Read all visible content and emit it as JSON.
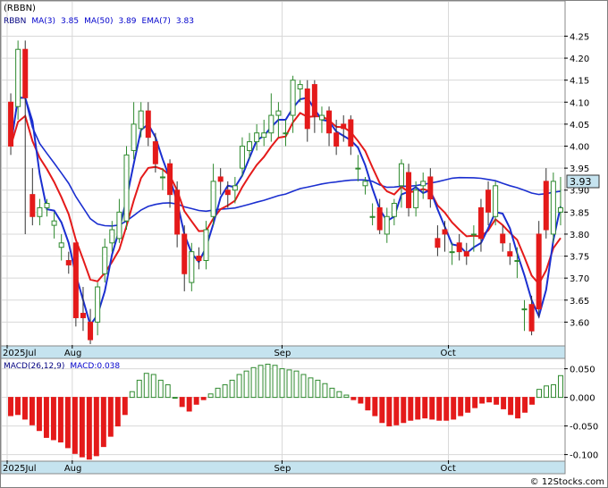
{
  "ticker_title": "(RBBN)",
  "watermark": "© 12Stocks.com",
  "colors": {
    "up": "#2f8a2f",
    "down": "#e41a1a",
    "ma_blue": "#1b2fd0",
    "ema_red": "#e41a1a",
    "axis_strip": "#c5e3ef",
    "price_box": "#c5e3ef",
    "grid": "#d8d8d8"
  },
  "chart_data": [
    {
      "type": "candlestick",
      "legend": [
        {
          "text": "RBBN",
          "color": "#000080"
        },
        {
          "text": "MA(3)",
          "color": "#0000cc"
        },
        {
          "text": "3.85",
          "color": "#0000cc"
        },
        {
          "text": "MA(50)",
          "color": "#0000cc"
        },
        {
          "text": "3.89",
          "color": "#0000cc"
        },
        {
          "text": "EMA(7)",
          "color": "#0000cc"
        },
        {
          "text": "3.83",
          "color": "#0000cc"
        }
      ],
      "y_axis": {
        "ticks": [
          "3.60",
          "3.65",
          "3.70",
          "3.75",
          "3.80",
          "3.85",
          "3.90",
          "3.95",
          "4.00",
          "4.05",
          "4.10",
          "4.15",
          "4.20",
          "4.25"
        ],
        "range": [
          3.55,
          4.32
        ],
        "position": "right"
      },
      "x_axis_labels": [
        "2025Jul",
        "Aug",
        "Sep",
        "Oct"
      ],
      "label_day_index": [
        0,
        9,
        38,
        61
      ],
      "last_price": "3.93",
      "days": 77,
      "open": [
        4.1,
        4.09,
        4.22,
        3.89,
        3.84,
        3.86,
        3.82,
        3.77,
        3.74,
        3.78,
        3.62,
        3.6,
        3.6,
        3.71,
        3.78,
        3.79,
        3.83,
        3.99,
        4.04,
        4.08,
        4.01,
        3.93,
        3.96,
        3.9,
        3.8,
        3.69,
        3.75,
        3.74,
        3.84,
        3.93,
        3.9,
        3.9,
        3.95,
        3.99,
        4.01,
        4.02,
        4.03,
        4.07,
        4.03,
        4.07,
        4.13,
        4.13,
        4.14,
        4.06,
        4.08,
        4.03,
        4.05,
        4.06,
        3.95,
        3.91,
        3.84,
        3.86,
        3.8,
        3.84,
        3.91,
        3.94,
        3.86,
        3.91,
        3.93,
        3.79,
        3.81,
        3.76,
        3.78,
        3.76,
        3.8,
        3.86,
        3.9,
        3.84,
        3.8,
        3.76,
        3.74,
        3.63,
        3.64,
        3.8,
        3.92,
        3.8,
        3.85
      ],
      "close": [
        4.0,
        4.22,
        4.11,
        3.84,
        3.86,
        3.87,
        3.83,
        3.78,
        3.73,
        3.61,
        3.61,
        3.56,
        3.68,
        3.77,
        3.81,
        3.85,
        3.98,
        4.05,
        4.08,
        4.02,
        3.96,
        3.93,
        3.89,
        3.8,
        3.71,
        3.76,
        3.74,
        3.81,
        3.92,
        3.92,
        3.89,
        3.91,
        4.0,
        4.01,
        4.03,
        4.03,
        4.07,
        4.08,
        4.03,
        4.15,
        4.14,
        4.04,
        4.07,
        4.07,
        4.03,
        4.0,
        4.04,
        4.0,
        3.95,
        3.92,
        3.84,
        3.81,
        3.84,
        3.87,
        3.96,
        3.86,
        3.9,
        3.92,
        3.88,
        3.77,
        3.8,
        3.76,
        3.76,
        3.75,
        3.8,
        3.79,
        3.85,
        3.91,
        3.78,
        3.75,
        3.74,
        3.63,
        3.58,
        3.63,
        3.81,
        3.92,
        3.86
      ],
      "high": [
        4.12,
        4.24,
        4.24,
        3.95,
        3.88,
        3.88,
        3.85,
        3.8,
        3.76,
        3.78,
        3.68,
        3.63,
        3.69,
        3.79,
        3.83,
        3.88,
        4.0,
        4.1,
        4.1,
        4.1,
        4.03,
        3.95,
        3.97,
        3.92,
        3.82,
        3.78,
        3.77,
        3.83,
        3.96,
        3.95,
        3.92,
        3.93,
        4.02,
        4.03,
        4.05,
        4.06,
        4.12,
        4.1,
        4.06,
        4.16,
        4.15,
        4.15,
        4.15,
        4.09,
        4.09,
        4.06,
        4.07,
        4.07,
        3.98,
        3.93,
        3.87,
        3.88,
        3.86,
        3.88,
        3.97,
        3.96,
        3.92,
        3.94,
        3.95,
        3.82,
        3.83,
        3.78,
        3.8,
        3.78,
        3.82,
        3.88,
        3.92,
        3.92,
        3.82,
        3.78,
        3.77,
        3.65,
        3.66,
        3.83,
        3.95,
        3.94,
        3.93
      ],
      "low": [
        3.98,
        4.06,
        3.8,
        3.82,
        3.82,
        3.84,
        3.79,
        3.74,
        3.71,
        3.59,
        3.58,
        3.55,
        3.57,
        3.69,
        3.76,
        3.78,
        3.81,
        3.97,
        4.02,
        4.0,
        3.94,
        3.9,
        3.86,
        3.77,
        3.67,
        3.67,
        3.72,
        3.72,
        3.82,
        3.89,
        3.86,
        3.87,
        3.93,
        3.97,
        3.99,
        4.0,
        4.01,
        4.02,
        4.0,
        4.03,
        4.1,
        4.01,
        4.03,
        4.03,
        4.0,
        3.98,
        4.01,
        3.98,
        3.92,
        3.89,
        3.82,
        3.8,
        3.78,
        3.82,
        3.86,
        3.84,
        3.84,
        3.88,
        3.86,
        3.75,
        3.76,
        3.73,
        3.74,
        3.73,
        3.76,
        3.76,
        3.82,
        3.82,
        3.76,
        3.73,
        3.7,
        3.58,
        3.57,
        3.61,
        3.79,
        3.78,
        3.82
      ]
    },
    {
      "type": "bar",
      "legend": [
        {
          "text": "MACD(26,12,9)",
          "color": "#000080"
        },
        {
          "text": "MACD:0.038",
          "color": "#0000cc"
        }
      ],
      "y_axis": {
        "ticks": [
          "0.050",
          "0.000",
          "-0.050",
          "-0.100"
        ],
        "range": [
          -0.11,
          0.065
        ],
        "position": "right"
      },
      "x_axis_labels": [
        "2025Jul",
        "Aug",
        "Sep",
        "Oct"
      ],
      "values": [
        -0.032,
        -0.03,
        -0.038,
        -0.048,
        -0.058,
        -0.07,
        -0.074,
        -0.078,
        -0.088,
        -0.098,
        -0.104,
        -0.108,
        -0.102,
        -0.086,
        -0.068,
        -0.05,
        -0.03,
        0.01,
        0.03,
        0.042,
        0.04,
        0.03,
        0.022,
        0.0,
        -0.016,
        -0.024,
        -0.012,
        -0.004,
        0.006,
        0.016,
        0.022,
        0.03,
        0.04,
        0.046,
        0.052,
        0.056,
        0.058,
        0.056,
        0.05,
        0.048,
        0.046,
        0.04,
        0.034,
        0.03,
        0.024,
        0.016,
        0.01,
        0.004,
        -0.004,
        -0.01,
        -0.022,
        -0.032,
        -0.044,
        -0.05,
        -0.048,
        -0.044,
        -0.04,
        -0.038,
        -0.036,
        -0.038,
        -0.04,
        -0.04,
        -0.038,
        -0.032,
        -0.026,
        -0.018,
        -0.01,
        -0.008,
        -0.012,
        -0.02,
        -0.03,
        -0.036,
        -0.026,
        -0.012,
        0.014,
        0.02,
        0.022,
        0.038
      ]
    }
  ]
}
